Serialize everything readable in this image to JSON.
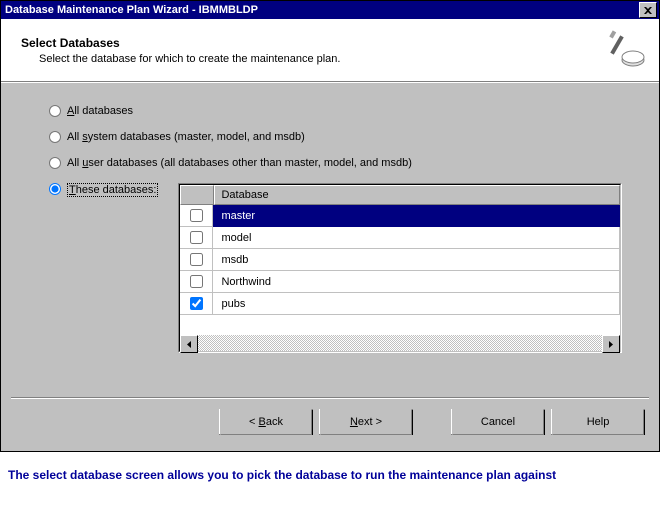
{
  "window": {
    "title": "Database Maintenance Plan Wizard - IBMMBLDP"
  },
  "header": {
    "title": "Select Databases",
    "description": "Select the database for which to create the maintenance plan."
  },
  "radios": {
    "all": {
      "prefix": "A",
      "rest": "ll databases"
    },
    "system": {
      "prefix": "All ",
      "und": "s",
      "rest": "ystem databases (master, model, and msdb)"
    },
    "user": {
      "prefix": "All ",
      "und": "u",
      "rest": "ser databases (all databases other than master, model, and msdb)"
    },
    "these": {
      "und": "T",
      "rest": "hese databases:"
    }
  },
  "db_table": {
    "header": "Database",
    "rows": [
      {
        "name": "master",
        "checked": false,
        "selected": true
      },
      {
        "name": "model",
        "checked": false,
        "selected": false
      },
      {
        "name": "msdb",
        "checked": false,
        "selected": false
      },
      {
        "name": "Northwind",
        "checked": false,
        "selected": false
      },
      {
        "name": "pubs",
        "checked": true,
        "selected": false
      }
    ]
  },
  "buttons": {
    "back": {
      "prefix": "< ",
      "und": "B",
      "rest": "ack"
    },
    "next": {
      "und": "N",
      "rest": "ext >"
    },
    "cancel": {
      "label": "Cancel"
    },
    "help": {
      "label": "Help"
    }
  },
  "caption": "The select database screen allows you to pick the database to run the maintenance plan against"
}
